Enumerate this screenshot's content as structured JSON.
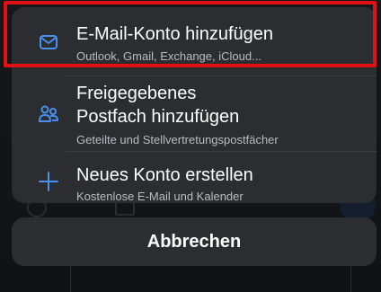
{
  "action_sheet": {
    "items": [
      {
        "title": "E-Mail-Konto hinzufügen",
        "subtitle": "Outlook, Gmail, Exchange, iCloud...",
        "icon": "mail-icon"
      },
      {
        "title_line1": "Freigegebenes",
        "title_line2": "Postfach hinzufügen",
        "subtitle": "Geteilte und Stellvertretungspostfächer",
        "icon": "people-icon"
      },
      {
        "title": "Neues Konto erstellen",
        "subtitle": "Kostenlose E-Mail und Kalender",
        "icon": "plus-icon"
      }
    ],
    "cancel_label": "Abbrechen"
  },
  "colors": {
    "accent": "#4a90f0",
    "highlight": "#e01014",
    "sheet_background": "#2b2d31",
    "backdrop": "#101214"
  }
}
